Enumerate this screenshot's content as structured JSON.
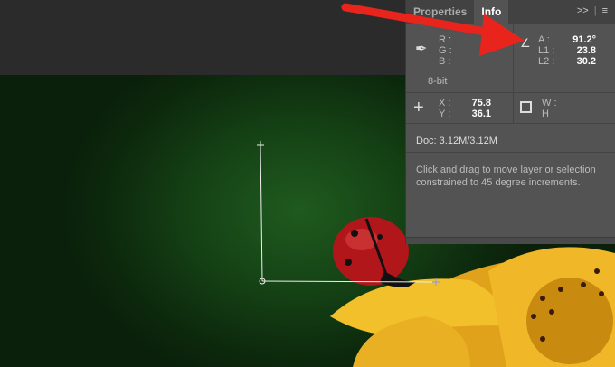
{
  "tabs": [
    {
      "label": "Properties"
    },
    {
      "label": "Info"
    }
  ],
  "panel_icons": {
    "expand": ">>",
    "menu": "menu-icon"
  },
  "color": {
    "r_label": "R :",
    "g_label": "G :",
    "b_label": "B :",
    "bit_depth": "8-bit"
  },
  "measure": {
    "a_label": "A :",
    "a_value": "91.2°",
    "l1_label": "L1 :",
    "l1_value": "23.8",
    "l2_label": "L2 :",
    "l2_value": "30.2"
  },
  "position": {
    "x_label": "X :",
    "x_value": "75.8",
    "y_label": "Y :",
    "y_value": "36.1"
  },
  "size": {
    "w_label": "W :",
    "h_label": "H :"
  },
  "doc": "Doc: 3.12M/3.12M",
  "hint": "Click and drag to move layer or selection constrained to 45 degree increments.",
  "colors": {
    "annotation_arrow": "#e8241c",
    "panel_bg": "#535353"
  }
}
